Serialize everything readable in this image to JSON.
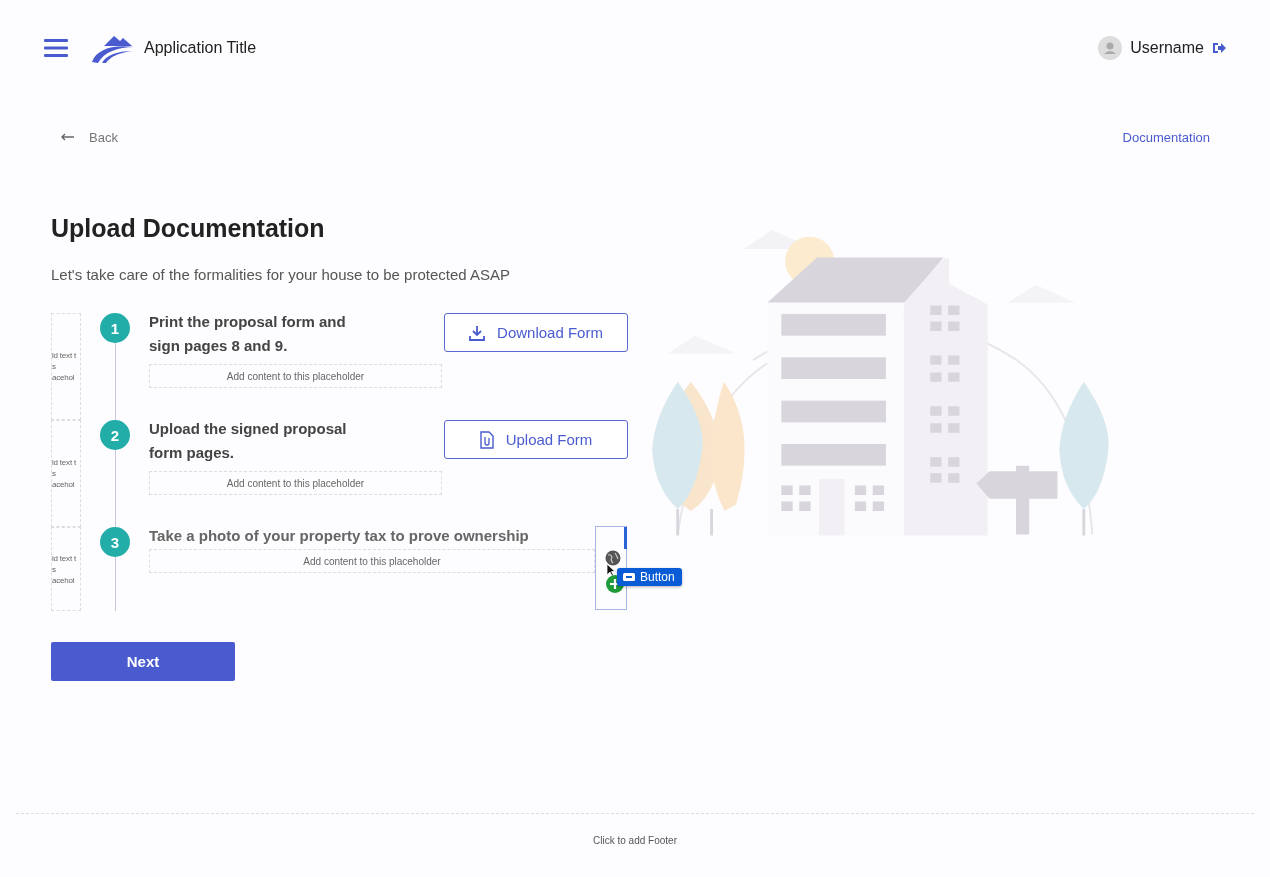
{
  "header": {
    "app_title": "Application Title",
    "username": "Username"
  },
  "nav": {
    "back": "Back",
    "documentation": "Documentation"
  },
  "page": {
    "title": "Upload Documentation",
    "subtitle": "Let's take care of the formalities for your house to be protected ASAP"
  },
  "steps": [
    {
      "number": "1",
      "title": "Print the proposal form and sign pages 8 and 9.",
      "placeholder": "Add content to this placeholder",
      "stub_lines": [
        "ld text t",
        "s",
        "acehol"
      ],
      "action": {
        "kind": "download",
        "label": "Download Form"
      }
    },
    {
      "number": "2",
      "title": "Upload the signed proposal form pages.",
      "placeholder": "Add content to this placeholder",
      "stub_lines": [
        "ld text t",
        "s",
        "acehol"
      ],
      "action": {
        "kind": "upload",
        "label": "Upload Form"
      }
    },
    {
      "number": "3",
      "title": "Take a photo of your property tax to prove ownership",
      "placeholder": "Add content to this placeholder",
      "stub_lines": [
        "ld text t",
        "s",
        "acehol"
      ],
      "drop_target": true
    }
  ],
  "drag_badge": {
    "label": "Button"
  },
  "next_button": "Next",
  "footer": "Click to add Footer"
}
